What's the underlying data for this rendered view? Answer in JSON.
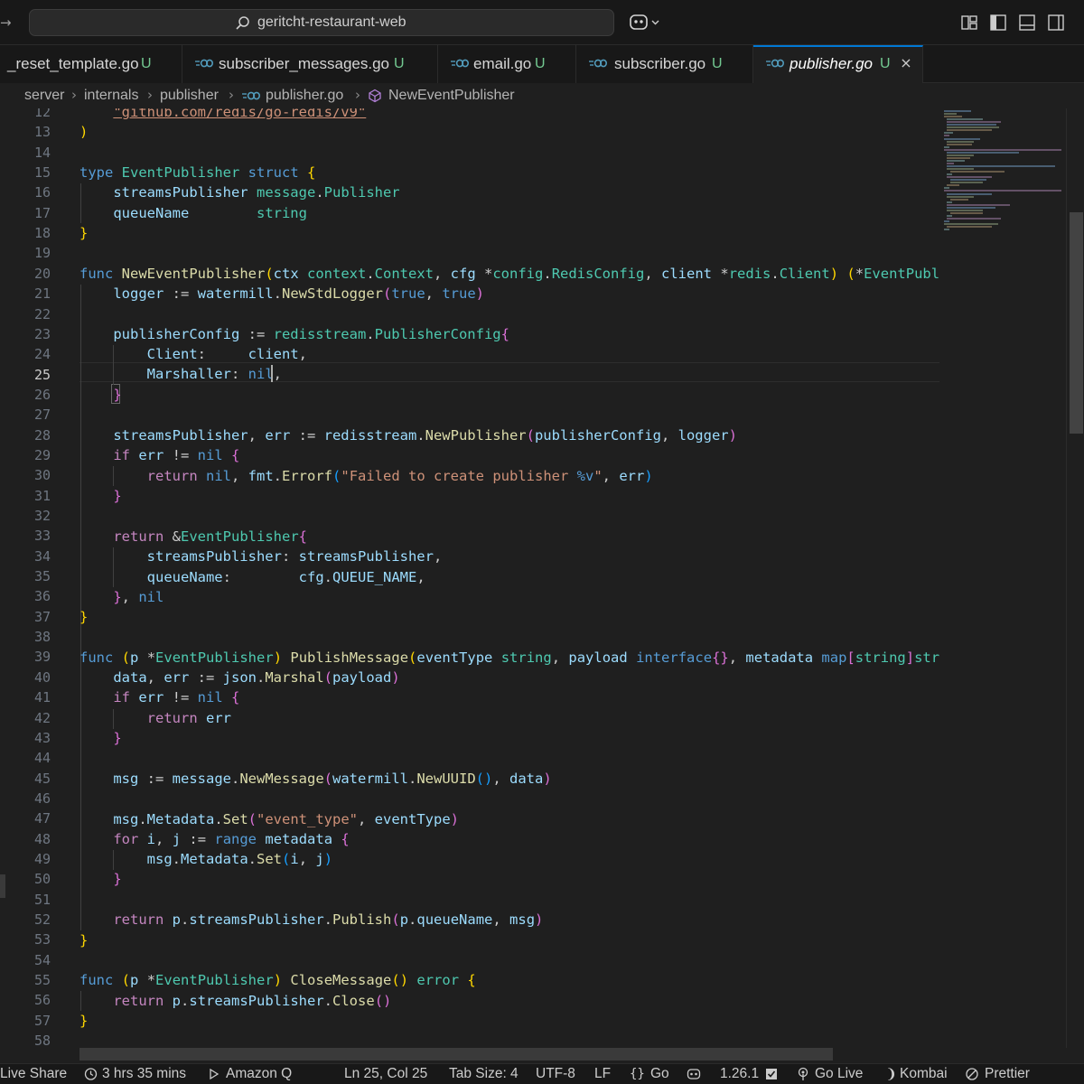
{
  "window": {
    "title": "geritcht-restaurant-web"
  },
  "tabs": [
    {
      "label": "_reset_template.go",
      "status": "U"
    },
    {
      "label": "subscriber_messages.go",
      "status": "U"
    },
    {
      "label": "email.go",
      "status": "U"
    },
    {
      "label": "subscriber.go",
      "status": "U"
    },
    {
      "label": "publisher.go",
      "status": "U",
      "active": true
    }
  ],
  "breadcrumb": [
    "server",
    "internals",
    "publisher",
    "publisher.go",
    "NewEventPublisher"
  ],
  "editor": {
    "active_line": 25,
    "line_numbers": [
      "12",
      "13",
      "14",
      "15",
      "16",
      "17",
      "18",
      "19",
      "20",
      "21",
      "22",
      "23",
      "24",
      "25",
      "26",
      "27",
      "28",
      "29",
      "30",
      "31",
      "32",
      "33",
      "34",
      "35",
      "36",
      "37",
      "38",
      "39",
      "40",
      "41",
      "42",
      "43",
      "44",
      "45",
      "46",
      "47",
      "48",
      "49",
      "50",
      "51",
      "52",
      "53",
      "54",
      "55",
      "56",
      "57",
      "58"
    ]
  },
  "status_bar": {
    "live_share": "Live Share",
    "time_tracker": "3 hrs 35 mins",
    "amazon_q": "Amazon Q",
    "cursor_position": "Ln 25, Col 25",
    "tab_size": "Tab Size: 4",
    "encoding": "UTF-8",
    "eol": "LF",
    "language": "Go",
    "go_version": "1.26.1",
    "go_live": "Go Live",
    "kombai": "Kombai",
    "prettier": "Prettier"
  },
  "colors": {
    "accent": "#0078d4",
    "untracked": "#73c991",
    "go_icon": "#519aba",
    "claude": "#d97757"
  }
}
